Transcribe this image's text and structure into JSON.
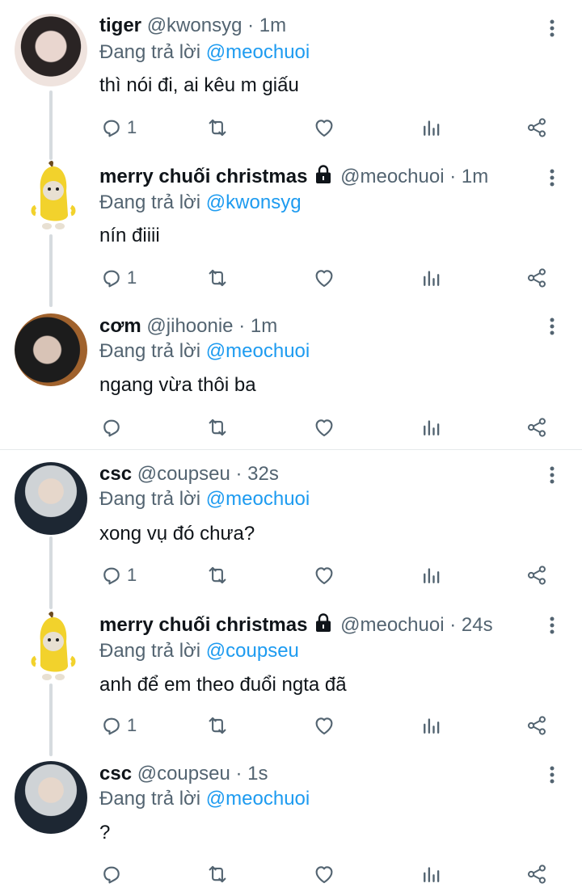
{
  "reply_prefix": "Đang trả lời ",
  "tweets": [
    {
      "name": "tiger",
      "handle": "@kwonsyg",
      "time": "1m",
      "locked": false,
      "reply_to": "@meochuoi",
      "text": "thì nói đi, ai kêu m giấu",
      "reply_count": "1"
    },
    {
      "name": "merry chuối christmas",
      "handle": "@meochuoi",
      "time": "1m",
      "locked": true,
      "reply_to": "@kwonsyg",
      "text": "nín điiii",
      "reply_count": "1"
    },
    {
      "name": "cơm",
      "handle": "@jihoonie",
      "time": "1m",
      "locked": false,
      "reply_to": "@meochuoi",
      "text": "ngang vừa thôi ba",
      "reply_count": ""
    },
    {
      "name": "csc",
      "handle": "@coupseu",
      "time": "32s",
      "locked": false,
      "reply_to": "@meochuoi",
      "text": "xong vụ đó chưa?",
      "reply_count": "1"
    },
    {
      "name": "merry chuối christmas",
      "handle": "@meochuoi",
      "time": "24s",
      "locked": true,
      "reply_to": "@coupseu",
      "text": "anh để em theo đuổi ngta đã",
      "reply_count": "1"
    },
    {
      "name": "csc",
      "handle": "@coupseu",
      "time": "1s",
      "locked": false,
      "reply_to": "@meochuoi",
      "text": "?",
      "reply_count": ""
    }
  ],
  "icons": {
    "reply": "reply-icon",
    "retweet": "retweet-icon",
    "like": "heart-icon",
    "views": "views-icon",
    "share": "share-icon",
    "more": "more-icon",
    "lock": "lock-icon"
  },
  "colors": {
    "name": "#0f1419",
    "secondary": "#536471",
    "mention": "#1d9bf0",
    "thread_line": "#d6dbdf"
  }
}
